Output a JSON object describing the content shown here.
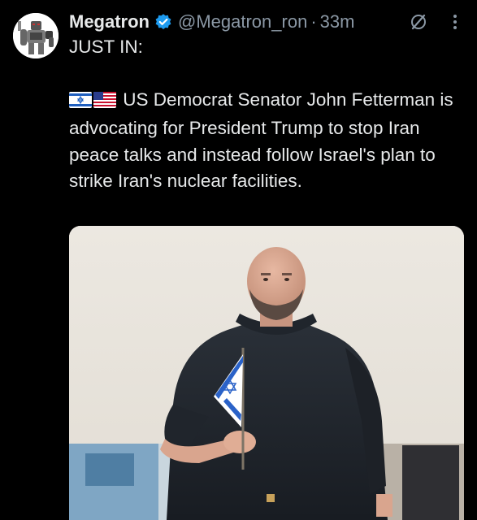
{
  "tweet": {
    "display_name": "Megatron",
    "handle": "@Megatron_ron",
    "separator": "·",
    "time": "33m",
    "line1": "JUST IN:",
    "body": "US Democrat Senator John Fetterman is advocating for President Trump to stop Iran peace talks and instead follow Israel's plan to strike Iran's nuclear facilities.",
    "verified": true
  },
  "icons": {
    "avatar": "robot-avatar",
    "verified": "verified-badge-icon",
    "grok": "grok-icon",
    "more": "more-vertical-icon",
    "flags": [
      "israel-flag-icon",
      "us-flag-icon"
    ]
  },
  "colors": {
    "background": "#000000",
    "text": "#e7e9ea",
    "secondary": "#8b98a5",
    "verified": "#1d9bf0"
  }
}
